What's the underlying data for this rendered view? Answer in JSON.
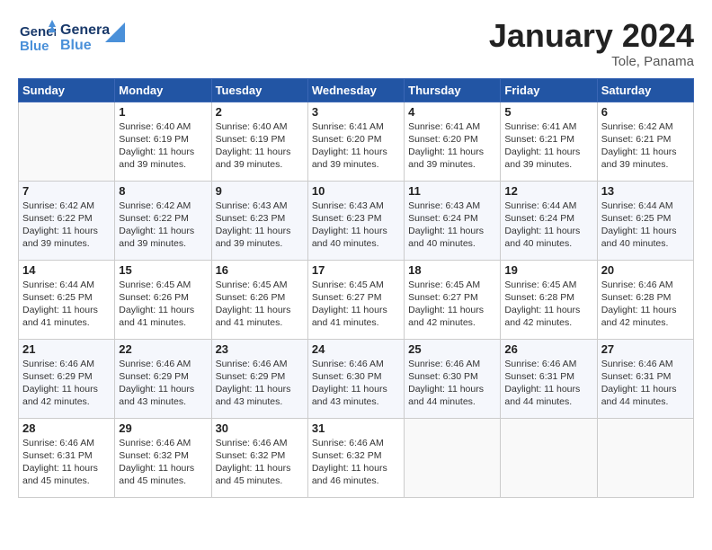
{
  "header": {
    "logo_line1": "General",
    "logo_line2": "Blue",
    "title": "January 2024",
    "subtitle": "Tole, Panama"
  },
  "weekdays": [
    "Sunday",
    "Monday",
    "Tuesday",
    "Wednesday",
    "Thursday",
    "Friday",
    "Saturday"
  ],
  "weeks": [
    [
      {
        "day": "",
        "info": ""
      },
      {
        "day": "1",
        "info": "Sunrise: 6:40 AM\nSunset: 6:19 PM\nDaylight: 11 hours\nand 39 minutes."
      },
      {
        "day": "2",
        "info": "Sunrise: 6:40 AM\nSunset: 6:19 PM\nDaylight: 11 hours\nand 39 minutes."
      },
      {
        "day": "3",
        "info": "Sunrise: 6:41 AM\nSunset: 6:20 PM\nDaylight: 11 hours\nand 39 minutes."
      },
      {
        "day": "4",
        "info": "Sunrise: 6:41 AM\nSunset: 6:20 PM\nDaylight: 11 hours\nand 39 minutes."
      },
      {
        "day": "5",
        "info": "Sunrise: 6:41 AM\nSunset: 6:21 PM\nDaylight: 11 hours\nand 39 minutes."
      },
      {
        "day": "6",
        "info": "Sunrise: 6:42 AM\nSunset: 6:21 PM\nDaylight: 11 hours\nand 39 minutes."
      }
    ],
    [
      {
        "day": "7",
        "info": "Sunrise: 6:42 AM\nSunset: 6:22 PM\nDaylight: 11 hours\nand 39 minutes."
      },
      {
        "day": "8",
        "info": "Sunrise: 6:42 AM\nSunset: 6:22 PM\nDaylight: 11 hours\nand 39 minutes."
      },
      {
        "day": "9",
        "info": "Sunrise: 6:43 AM\nSunset: 6:23 PM\nDaylight: 11 hours\nand 39 minutes."
      },
      {
        "day": "10",
        "info": "Sunrise: 6:43 AM\nSunset: 6:23 PM\nDaylight: 11 hours\nand 40 minutes."
      },
      {
        "day": "11",
        "info": "Sunrise: 6:43 AM\nSunset: 6:24 PM\nDaylight: 11 hours\nand 40 minutes."
      },
      {
        "day": "12",
        "info": "Sunrise: 6:44 AM\nSunset: 6:24 PM\nDaylight: 11 hours\nand 40 minutes."
      },
      {
        "day": "13",
        "info": "Sunrise: 6:44 AM\nSunset: 6:25 PM\nDaylight: 11 hours\nand 40 minutes."
      }
    ],
    [
      {
        "day": "14",
        "info": "Sunrise: 6:44 AM\nSunset: 6:25 PM\nDaylight: 11 hours\nand 41 minutes."
      },
      {
        "day": "15",
        "info": "Sunrise: 6:45 AM\nSunset: 6:26 PM\nDaylight: 11 hours\nand 41 minutes."
      },
      {
        "day": "16",
        "info": "Sunrise: 6:45 AM\nSunset: 6:26 PM\nDaylight: 11 hours\nand 41 minutes."
      },
      {
        "day": "17",
        "info": "Sunrise: 6:45 AM\nSunset: 6:27 PM\nDaylight: 11 hours\nand 41 minutes."
      },
      {
        "day": "18",
        "info": "Sunrise: 6:45 AM\nSunset: 6:27 PM\nDaylight: 11 hours\nand 42 minutes."
      },
      {
        "day": "19",
        "info": "Sunrise: 6:45 AM\nSunset: 6:28 PM\nDaylight: 11 hours\nand 42 minutes."
      },
      {
        "day": "20",
        "info": "Sunrise: 6:46 AM\nSunset: 6:28 PM\nDaylight: 11 hours\nand 42 minutes."
      }
    ],
    [
      {
        "day": "21",
        "info": "Sunrise: 6:46 AM\nSunset: 6:29 PM\nDaylight: 11 hours\nand 42 minutes."
      },
      {
        "day": "22",
        "info": "Sunrise: 6:46 AM\nSunset: 6:29 PM\nDaylight: 11 hours\nand 43 minutes."
      },
      {
        "day": "23",
        "info": "Sunrise: 6:46 AM\nSunset: 6:29 PM\nDaylight: 11 hours\nand 43 minutes."
      },
      {
        "day": "24",
        "info": "Sunrise: 6:46 AM\nSunset: 6:30 PM\nDaylight: 11 hours\nand 43 minutes."
      },
      {
        "day": "25",
        "info": "Sunrise: 6:46 AM\nSunset: 6:30 PM\nDaylight: 11 hours\nand 44 minutes."
      },
      {
        "day": "26",
        "info": "Sunrise: 6:46 AM\nSunset: 6:31 PM\nDaylight: 11 hours\nand 44 minutes."
      },
      {
        "day": "27",
        "info": "Sunrise: 6:46 AM\nSunset: 6:31 PM\nDaylight: 11 hours\nand 44 minutes."
      }
    ],
    [
      {
        "day": "28",
        "info": "Sunrise: 6:46 AM\nSunset: 6:31 PM\nDaylight: 11 hours\nand 45 minutes."
      },
      {
        "day": "29",
        "info": "Sunrise: 6:46 AM\nSunset: 6:32 PM\nDaylight: 11 hours\nand 45 minutes."
      },
      {
        "day": "30",
        "info": "Sunrise: 6:46 AM\nSunset: 6:32 PM\nDaylight: 11 hours\nand 45 minutes."
      },
      {
        "day": "31",
        "info": "Sunrise: 6:46 AM\nSunset: 6:32 PM\nDaylight: 11 hours\nand 46 minutes."
      },
      {
        "day": "",
        "info": ""
      },
      {
        "day": "",
        "info": ""
      },
      {
        "day": "",
        "info": ""
      }
    ]
  ]
}
